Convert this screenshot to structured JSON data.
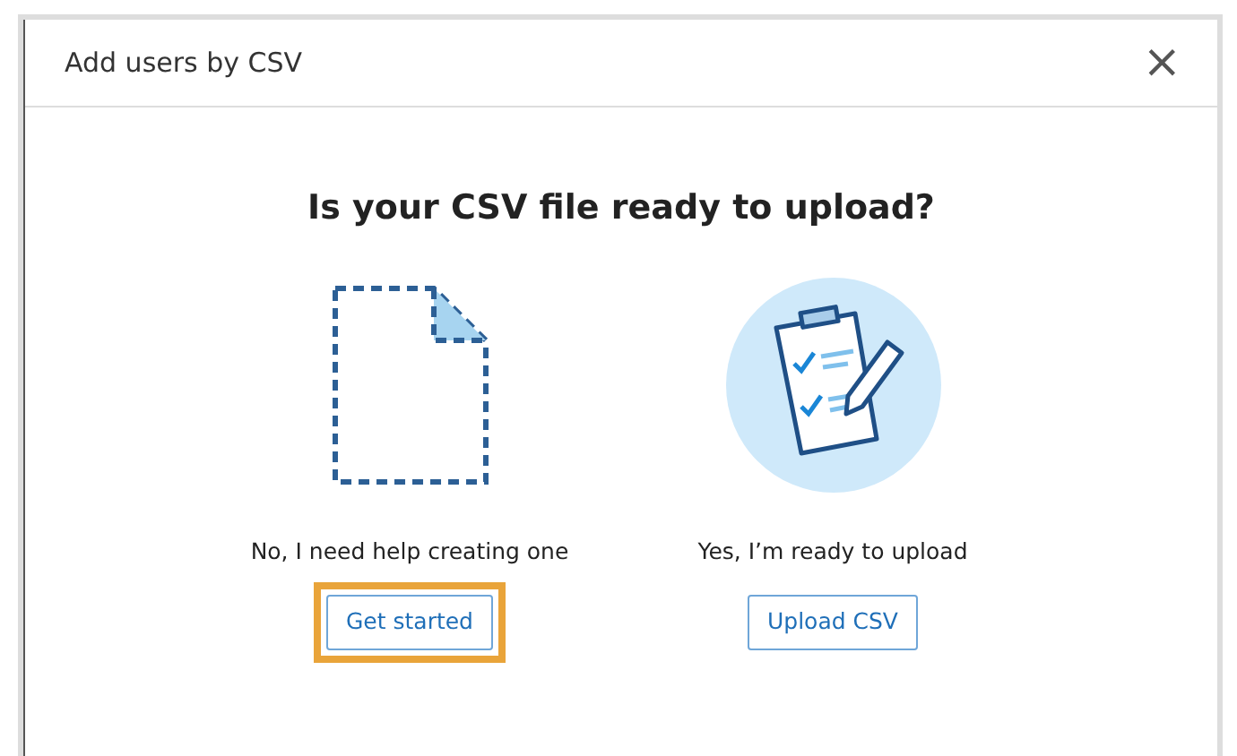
{
  "dialog": {
    "title": "Add users by CSV",
    "close": "×"
  },
  "heading": "Is your CSV file ready to upload?",
  "options": [
    {
      "kind": "template",
      "caption": "No, I need help creating one",
      "button": "Get started",
      "highlighted": true
    },
    {
      "kind": "upload",
      "caption": "Yes, I’m ready to upload",
      "button": "Upload CSV",
      "highlighted": false
    }
  ]
}
